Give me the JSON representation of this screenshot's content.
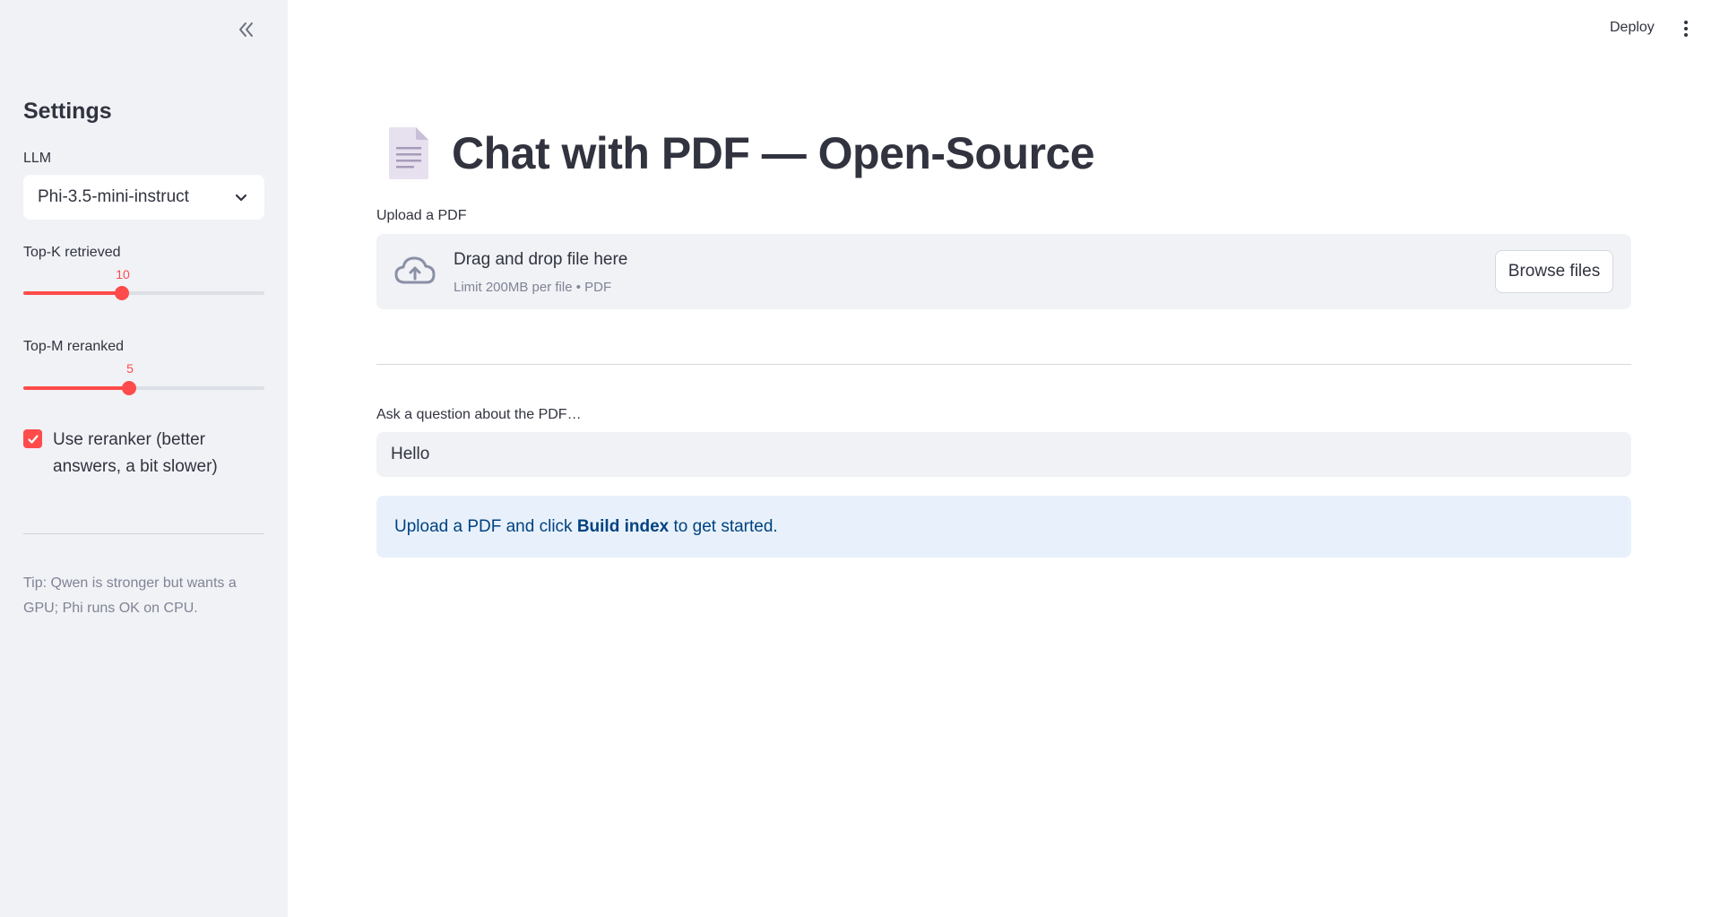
{
  "sidebar": {
    "title": "Settings",
    "llm": {
      "label": "LLM",
      "selected": "Phi-3.5-mini-instruct"
    },
    "top_k": {
      "label": "Top-K retrieved",
      "value": 10,
      "display": "10",
      "fraction": 0.41
    },
    "top_m": {
      "label": "Top-M reranked",
      "value": 5,
      "display": "5",
      "fraction": 0.44
    },
    "reranker": {
      "label": "Use reranker (better answers, a bit slower)",
      "checked": true
    },
    "tip": "Tip: Qwen is stronger but wants a GPU; Phi runs OK on CPU."
  },
  "header": {
    "deploy": "Deploy"
  },
  "main": {
    "title": "Chat with PDF — Open-Source",
    "upload": {
      "label": "Upload a PDF",
      "drag_text": "Drag and drop file here",
      "limit_text": "Limit 200MB per file • PDF",
      "browse_label": "Browse files"
    },
    "question": {
      "label": "Ask a question about the PDF…",
      "value": "Hello"
    },
    "info": {
      "prefix": "Upload a PDF and click ",
      "bold": "Build index",
      "suffix": " to get started."
    }
  },
  "colors": {
    "accent": "#ff4b4b",
    "sidebar_bg": "#f0f2f6",
    "info_bg": "#e8f1fb",
    "info_text": "#004280"
  }
}
